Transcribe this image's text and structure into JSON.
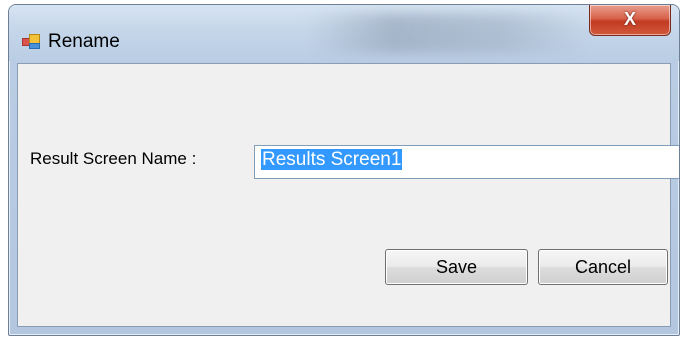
{
  "window": {
    "title": "Rename",
    "close_label": "X"
  },
  "form": {
    "label": "Result Screen Name :",
    "value": "Results Screen1"
  },
  "buttons": {
    "save": "Save",
    "cancel": "Cancel"
  }
}
